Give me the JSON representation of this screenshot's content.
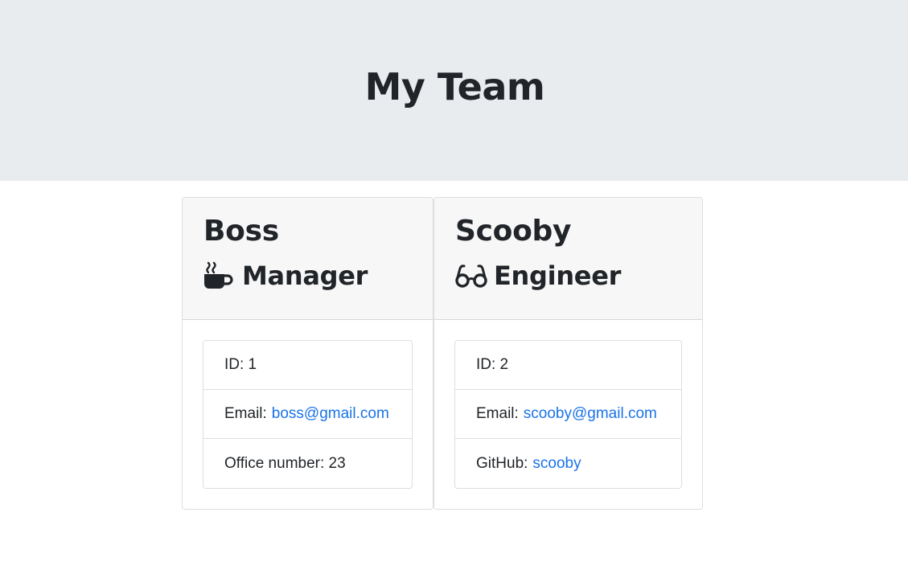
{
  "header": {
    "title": "My Team"
  },
  "team": [
    {
      "name": "Boss",
      "role": "Manager",
      "role_icon": "coffee-mug-icon",
      "id_label": "ID: 1",
      "email_label": "Email:",
      "email": "boss@gmail.com",
      "extra_label": "Office number: 23"
    },
    {
      "name": "Scooby",
      "role": "Engineer",
      "role_icon": "glasses-icon",
      "id_label": "ID: 2",
      "email_label": "Email:",
      "email": "scooby@gmail.com",
      "extra_label": "GitHub:",
      "extra_link": "scooby"
    }
  ],
  "colors": {
    "jumbotron_bg": "#e9ecef",
    "link": "#1a73e8",
    "card_header_bg": "#f7f7f7"
  }
}
